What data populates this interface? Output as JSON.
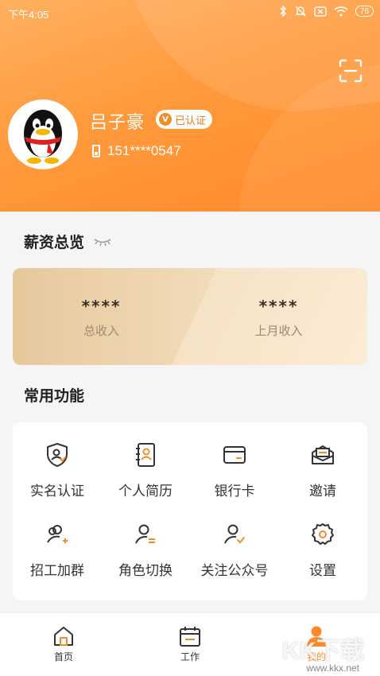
{
  "status_bar": {
    "time": "下午4:05",
    "battery": "76"
  },
  "profile": {
    "name": "吕子豪",
    "badge": "已认证",
    "phone": "151****0547"
  },
  "salary": {
    "title": "薪资总览",
    "total": {
      "value": "****",
      "label": "总收入"
    },
    "last_month": {
      "value": "****",
      "label": "上月收入"
    }
  },
  "functions": {
    "title": "常用功能",
    "items": [
      {
        "label": "实名认证",
        "icon": "shield-user-icon"
      },
      {
        "label": "个人简历",
        "icon": "resume-icon"
      },
      {
        "label": "银行卡",
        "icon": "bank-card-icon"
      },
      {
        "label": "邀请",
        "icon": "invite-icon"
      },
      {
        "label": "招工加群",
        "icon": "add-group-icon"
      },
      {
        "label": "角色切换",
        "icon": "switch-role-icon"
      },
      {
        "label": "关注公众号",
        "icon": "follow-account-icon"
      },
      {
        "label": "设置",
        "icon": "gear-icon"
      }
    ]
  },
  "tabs": [
    {
      "label": "首页",
      "icon": "home-icon"
    },
    {
      "label": "工作",
      "icon": "calendar-icon"
    },
    {
      "label": "我的",
      "icon": "profile-icon",
      "active": true
    }
  ],
  "watermark": {
    "main": "KK下载",
    "sub": "www.kkx.net"
  },
  "colors": {
    "accent": "#ff8a2a",
    "icon_orange": "#f08f2a",
    "icon_gray": "#333333"
  }
}
